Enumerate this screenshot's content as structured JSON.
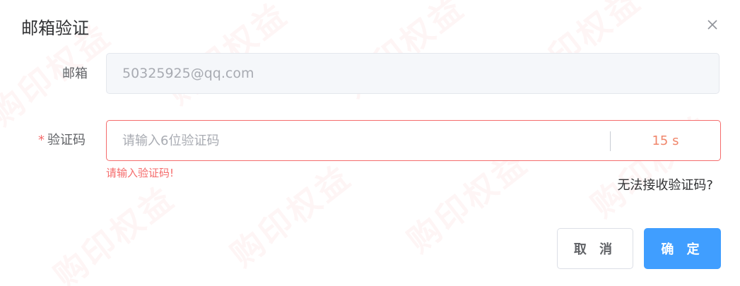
{
  "dialog": {
    "title": "邮箱验证",
    "close_icon": "close-icon"
  },
  "watermark": {
    "text": "购印权益"
  },
  "email": {
    "label": "邮箱",
    "value": "50325925@qq.com",
    "disabled": true
  },
  "code": {
    "required_mark": "*",
    "label": "验证码",
    "placeholder": "请输入6位验证码",
    "value": "",
    "countdown": "15 s",
    "error": "请输入验证码!"
  },
  "help_link": "无法接收验证码?",
  "buttons": {
    "cancel": "取 消",
    "confirm": "确 定"
  },
  "colors": {
    "primary": "#409eff",
    "error": "#f56c6c",
    "countdown": "#f0866b",
    "disabled_bg": "#f5f7fa"
  }
}
